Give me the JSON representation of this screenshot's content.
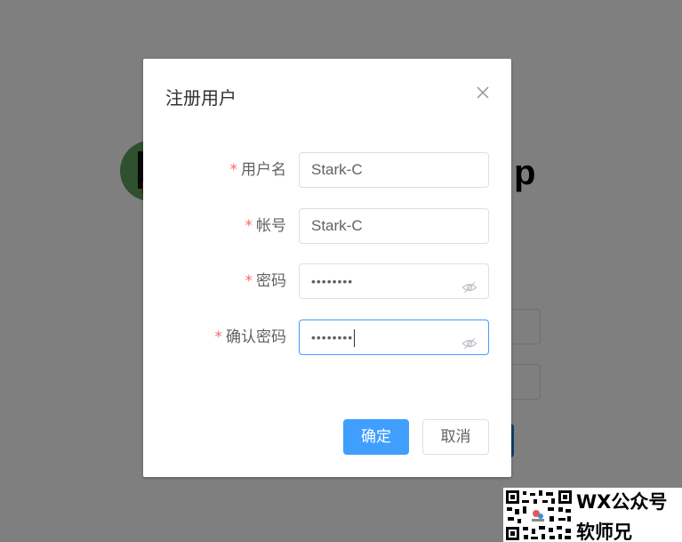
{
  "background": {
    "title_fragment": "p"
  },
  "dialog": {
    "title": "注册用户",
    "fields": [
      {
        "required_mark": "*",
        "label": "用户名",
        "value": "Stark-C",
        "type": "text"
      },
      {
        "required_mark": "*",
        "label": "帐号",
        "value": "Stark-C",
        "type": "text"
      },
      {
        "required_mark": "*",
        "label": "密码",
        "value": "••••••••",
        "type": "password"
      },
      {
        "required_mark": "*",
        "label": "确认密码",
        "value": "••••••••",
        "type": "password",
        "focused": true
      }
    ],
    "confirm_label": "确定",
    "cancel_label": "取消"
  },
  "watermark": {
    "line1": "WX公众号",
    "line2": "软师兄"
  },
  "colors": {
    "primary": "#409eff",
    "required": "#f56c6c",
    "overlay": "rgba(0,0,0,0.5)"
  },
  "icons": [
    "close-icon",
    "eye-off-icon",
    "qr-code-icon"
  ]
}
